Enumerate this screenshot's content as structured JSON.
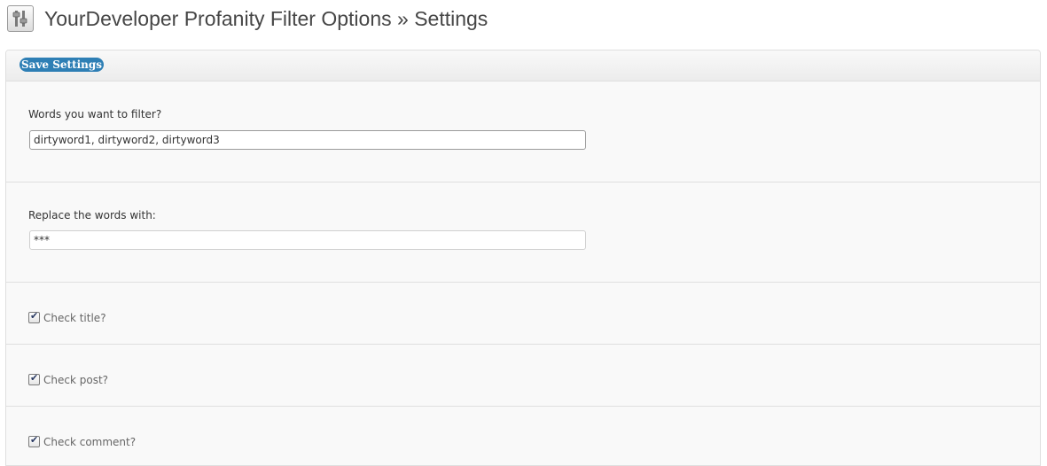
{
  "page": {
    "icon": "settings-sliders-icon",
    "title": "YourDeveloper Profanity Filter Options » Settings"
  },
  "toolbar": {
    "save_label": "Save Settings",
    "save_color": "#2e7fb5"
  },
  "fields": {
    "words": {
      "label": "Words you want to filter?",
      "value": "dirtyword1, dirtyword2, dirtyword3"
    },
    "replace": {
      "label": "Replace the words with:",
      "value": "***"
    }
  },
  "checkboxes": {
    "title": {
      "label": "Check title?",
      "checked": true
    },
    "post": {
      "label": "Check post?",
      "checked": true
    },
    "comment": {
      "label": "Check comment?",
      "checked": true
    }
  }
}
